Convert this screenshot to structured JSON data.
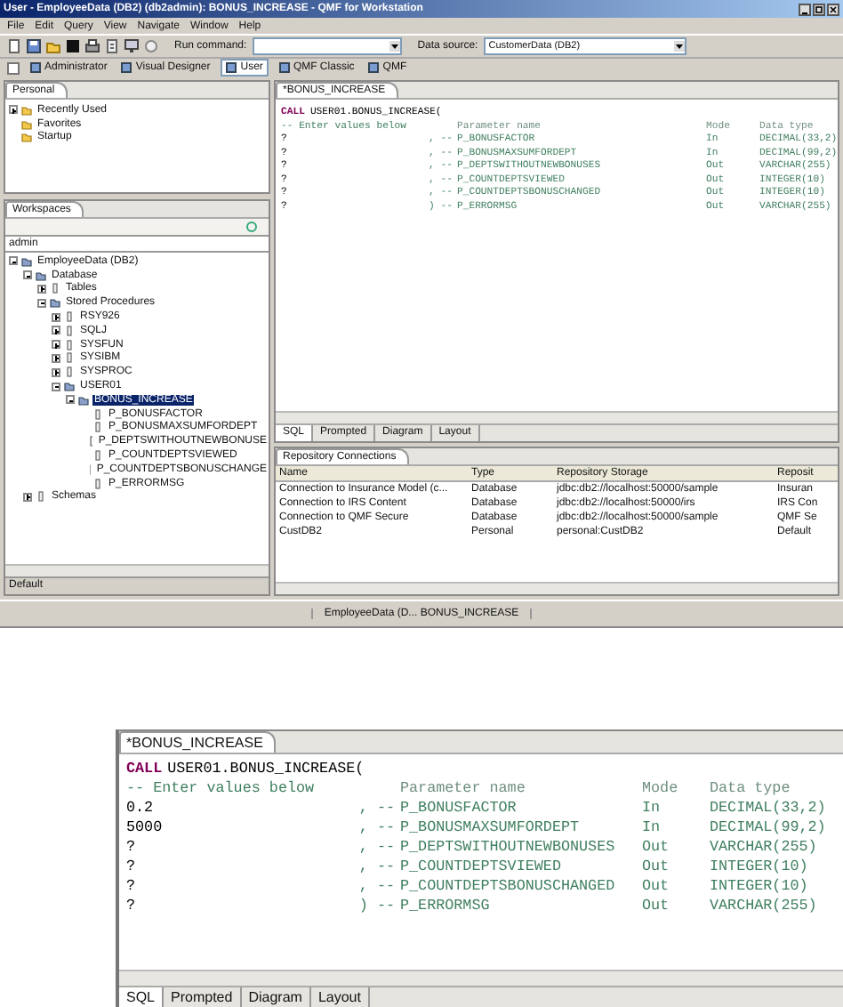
{
  "window": {
    "title": "User - EmployeeData (DB2) (db2admin): BONUS_INCREASE - QMF for Workstation"
  },
  "menu": [
    "File",
    "Edit",
    "Query",
    "View",
    "Navigate",
    "Window",
    "Help"
  ],
  "toolbar": {
    "run_command_label": "Run command:",
    "data_source_label": "Data source:",
    "data_source_value": "CustomerData (DB2)"
  },
  "perspectives": [
    {
      "label": "Administrator",
      "selected": false
    },
    {
      "label": "Visual Designer",
      "selected": false
    },
    {
      "label": "User",
      "selected": true
    },
    {
      "label": "QMF Classic",
      "selected": false
    },
    {
      "label": "QMF",
      "selected": false
    }
  ],
  "personal": {
    "title": "Personal",
    "items": [
      {
        "label": "Recently Used",
        "expanded": false
      },
      {
        "label": "Favorites"
      },
      {
        "label": "Startup"
      }
    ]
  },
  "workspaces": {
    "title": "Workspaces",
    "filter": "admin",
    "status": "Default",
    "tree": [
      {
        "label": "EmployeeData (DB2)",
        "expanded": true,
        "selected": false,
        "children": [
          {
            "label": "Database",
            "expanded": true,
            "selected": false,
            "children": [
              {
                "label": "Tables",
                "expanded": false,
                "selected": false
              },
              {
                "label": "Stored Procedures",
                "expanded": true,
                "selected": false,
                "children": [
                  {
                    "label": "RSY926",
                    "expanded": false,
                    "selected": false
                  },
                  {
                    "label": "SQLJ",
                    "expanded": false,
                    "selected": false
                  },
                  {
                    "label": "SYSFUN",
                    "expanded": false,
                    "selected": false
                  },
                  {
                    "label": "SYSIBM",
                    "expanded": false,
                    "selected": false
                  },
                  {
                    "label": "SYSPROC",
                    "expanded": false,
                    "selected": false
                  },
                  {
                    "label": "USER01",
                    "expanded": true,
                    "selected": false,
                    "children": [
                      {
                        "label": "BONUS_INCREASE",
                        "expanded": true,
                        "selected": true,
                        "children": [
                          {
                            "label": "P_BONUSFACTOR",
                            "selected": false
                          },
                          {
                            "label": "P_BONUSMAXSUMFORDEPT",
                            "selected": false
                          },
                          {
                            "label": "P_DEPTSWITHOUTNEWBONUSE",
                            "selected": false
                          },
                          {
                            "label": "P_COUNTDEPTSVIEWED",
                            "selected": false
                          },
                          {
                            "label": "P_COUNTDEPTSBONUSCHANGE",
                            "selected": false
                          },
                          {
                            "label": "P_ERRORMSG",
                            "selected": false
                          }
                        ]
                      }
                    ]
                  }
                ]
              }
            ]
          },
          {
            "label": "Schemas",
            "expanded": false,
            "selected": false
          }
        ]
      }
    ]
  },
  "editor": {
    "tab": "*BONUS_INCREASE",
    "keyword": "CALL",
    "call": "USER01.BONUS_INCREASE(",
    "comment": "-- Enter values below",
    "header": {
      "name": "Parameter name",
      "mode": "Mode",
      "type": "Data type"
    },
    "params": [
      {
        "value": "?",
        "separator": ", --",
        "name": "P_BONUSFACTOR",
        "mode": "In",
        "type": "DECIMAL(33,2)"
      },
      {
        "value": "?",
        "separator": ", --",
        "name": "P_BONUSMAXSUMFORDEPT",
        "mode": "In",
        "type": "DECIMAL(99,2)"
      },
      {
        "value": "?",
        "separator": ", --",
        "name": "P_DEPTSWITHOUTNEWBONUSES",
        "mode": "Out",
        "type": "VARCHAR(255)"
      },
      {
        "value": "?",
        "separator": ", --",
        "name": "P_COUNTDEPTSVIEWED",
        "mode": "Out",
        "type": "INTEGER(10)"
      },
      {
        "value": "?",
        "separator": ", --",
        "name": "P_COUNTDEPTSBONUSCHANGED",
        "mode": "Out",
        "type": "INTEGER(10)"
      },
      {
        "value": "?",
        "separator": ") --",
        "name": "P_ERRORMSG",
        "mode": "Out",
        "type": "VARCHAR(255)"
      }
    ],
    "tabs": [
      {
        "label": "SQL",
        "selected": true
      },
      {
        "label": "Prompted",
        "selected": false
      },
      {
        "label": "Diagram",
        "selected": false
      },
      {
        "label": "Layout",
        "selected": false
      }
    ]
  },
  "repository": {
    "title": "Repository Connections",
    "columns": [
      "Name",
      "Type",
      "Repository Storage",
      "Reposit"
    ],
    "rows": [
      [
        "Connection to Insurance Model (c...",
        "Database",
        "jdbc:db2://localhost:50000/sample",
        "Insuran"
      ],
      [
        "Connection to IRS Content",
        "Database",
        "jdbc:db2://localhost:50000/irs",
        "IRS Con"
      ],
      [
        "Connection to QMF Secure",
        "Database",
        "jdbc:db2://localhost:50000/sample",
        "QMF Se"
      ],
      [
        "CustDB2",
        "Personal",
        "personal:CustDB2",
        "Default"
      ]
    ]
  },
  "status_bar": "EmployeeData (D... BONUS_INCREASE",
  "zoomed_editor": {
    "tab": "*BONUS_INCREASE",
    "keyword": "CALL",
    "call": "USER01.BONUS_INCREASE(",
    "comment": "-- Enter values below",
    "header": {
      "name": "Parameter name",
      "mode": "Mode",
      "type": "Data type"
    },
    "params": [
      {
        "value": "0.2",
        "separator": ", --",
        "name": "P_BONUSFACTOR",
        "mode": "In",
        "type": "DECIMAL(33,2)"
      },
      {
        "value": "5000",
        "separator": ", --",
        "name": "P_BONUSMAXSUMFORDEPT",
        "mode": "In",
        "type": "DECIMAL(99,2)"
      },
      {
        "value": "?",
        "separator": ", --",
        "name": "P_DEPTSWITHOUTNEWBONUSES",
        "mode": "Out",
        "type": "VARCHAR(255)"
      },
      {
        "value": "?",
        "separator": ", --",
        "name": "P_COUNTDEPTSVIEWED",
        "mode": "Out",
        "type": "INTEGER(10)"
      },
      {
        "value": "?",
        "separator": ", --",
        "name": "P_COUNTDEPTSBONUSCHANGED",
        "mode": "Out",
        "type": "INTEGER(10)"
      },
      {
        "value": "?",
        "separator": ") --",
        "name": "P_ERRORMSG",
        "mode": "Out",
        "type": "VARCHAR(255)"
      }
    ],
    "tabs": [
      {
        "label": "SQL",
        "selected": true
      },
      {
        "label": "Prompted",
        "selected": false
      },
      {
        "label": "Diagram",
        "selected": false
      },
      {
        "label": "Layout",
        "selected": false
      }
    ]
  }
}
